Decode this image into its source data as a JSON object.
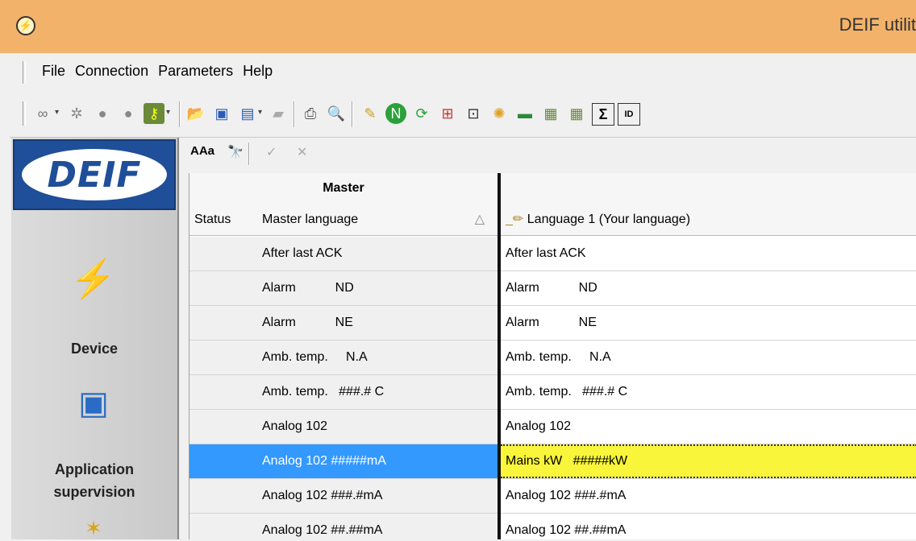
{
  "window": {
    "title": "DEIF utilit"
  },
  "menu": [
    "File",
    "Connection",
    "Parameters",
    "Help"
  ],
  "toolbar": {
    "icons": [
      "link-icon",
      "snowflake-icon",
      "people-icon",
      "people-icon",
      "key-icon",
      "open-folder-icon",
      "save-icon",
      "save-all-icon",
      "upload-icon",
      "print-icon",
      "print-preview-icon",
      "ruler-icon",
      "n-circle-icon",
      "refresh-icon",
      "add-param-icon",
      "edit-param-icon",
      "sparkle-icon",
      "battery-icon",
      "download-icon",
      "download-2-icon",
      "sigma-icon",
      "id-icon"
    ]
  },
  "sidebar": {
    "logo_text": "DEIF",
    "items": [
      {
        "label": "Device",
        "icon": "factory-lightning-icon"
      },
      {
        "label": "Application supervision",
        "icon": "application-monitor-icon"
      },
      {
        "label": "",
        "icon": "new-document-icon"
      }
    ]
  },
  "subtoolbar": {
    "font_label": "AAa",
    "find_icon": "binoculars-icon",
    "check_icon": "check-icon",
    "cross_icon": "cross-icon"
  },
  "grid": {
    "group_header": "Master",
    "columns": {
      "status": "Status",
      "master": "Master language",
      "sort_indicator": "△",
      "language": "Language 1 (Your language)"
    },
    "rows": [
      {
        "status": "",
        "master": "After last ACK",
        "language": "After last ACK"
      },
      {
        "status": "",
        "master": "Alarm           ND",
        "language": "Alarm           ND"
      },
      {
        "status": "",
        "master": "Alarm           NE",
        "language": "Alarm           NE"
      },
      {
        "status": "",
        "master": "Amb. temp.     N.A",
        "language": "Amb. temp.     N.A"
      },
      {
        "status": "",
        "master": "Amb. temp.   ###.# C",
        "language": "Amb. temp.   ###.# C"
      },
      {
        "status": "",
        "master": "Analog 102",
        "language": "Analog 102"
      },
      {
        "status": "",
        "master": "Analog 102 #####mA",
        "language": "Mains kW   #####kW",
        "selected": true
      },
      {
        "status": "",
        "master": "Analog 102 ###.#mA",
        "language": "Analog 102 ###.#mA"
      },
      {
        "status": "",
        "master": "Analog 102 ##.##mA",
        "language": "Analog 102 ##.##mA"
      }
    ]
  }
}
